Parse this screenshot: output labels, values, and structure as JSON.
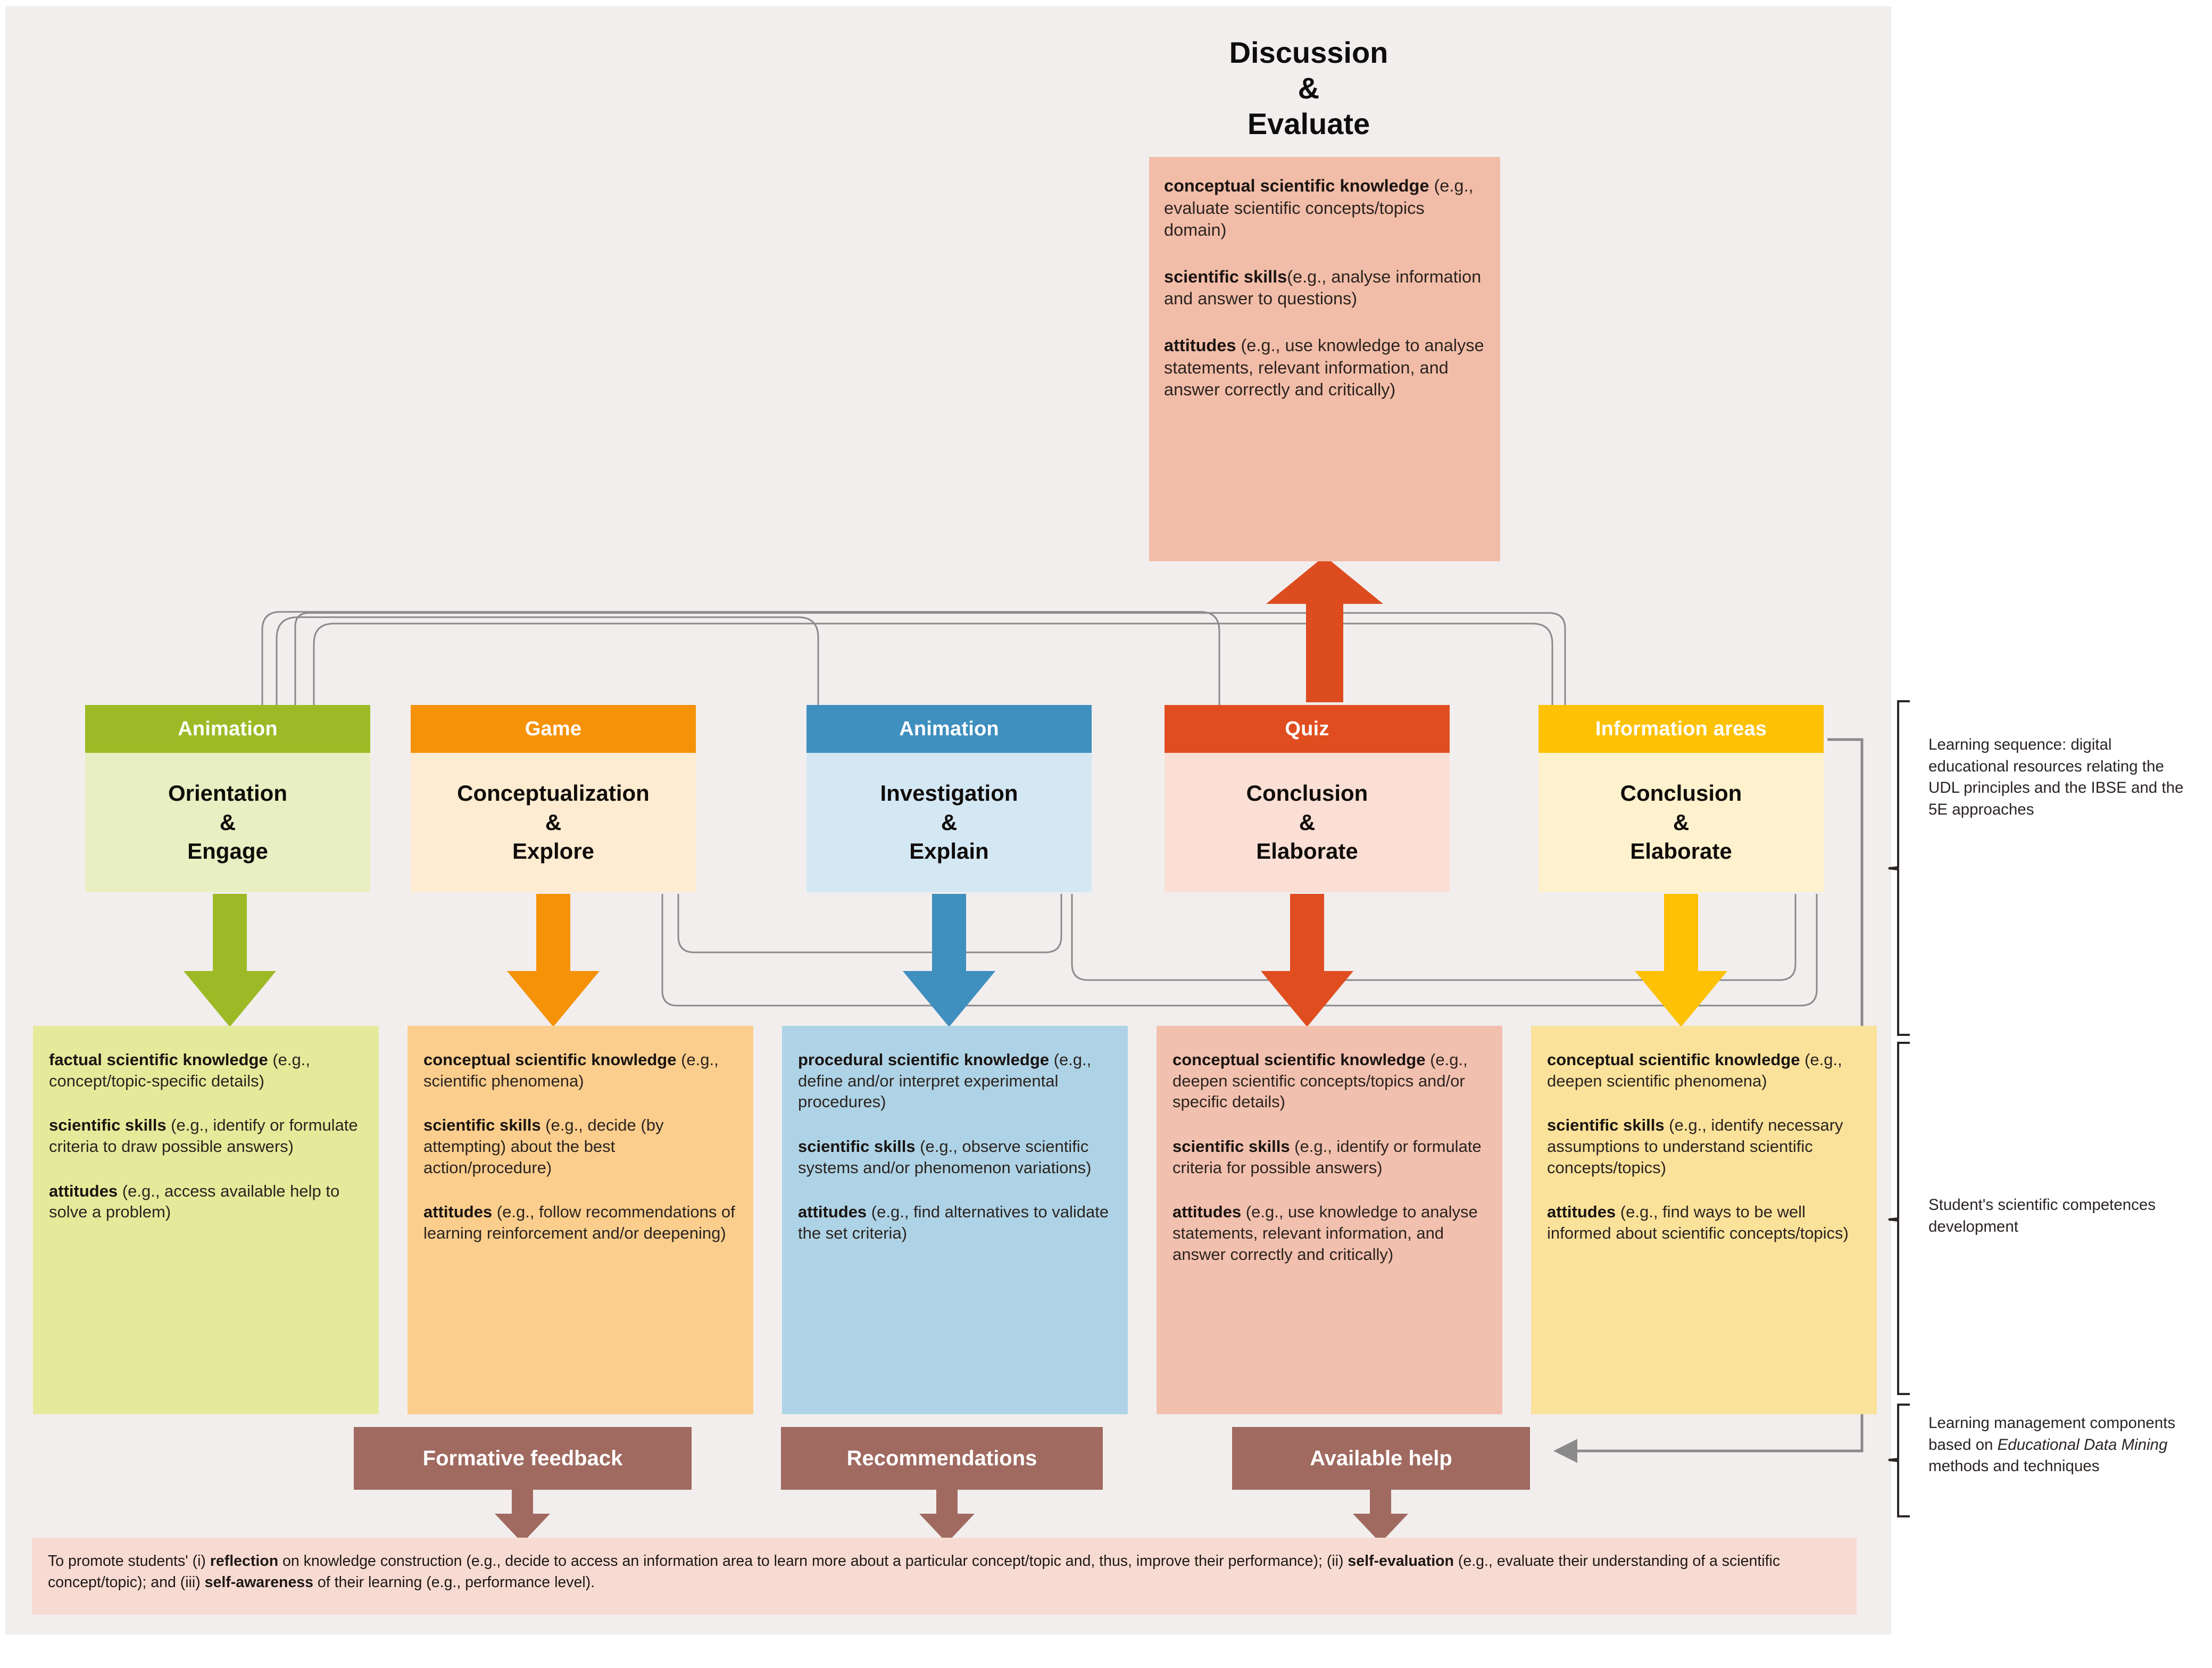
{
  "diagram": {
    "title": "Discussion\n&\nEvaluate",
    "title_lines": [
      "Discussion",
      "&",
      "Evaluate"
    ]
  },
  "colors": {
    "canvas_bg": "#f2eeee",
    "green_header": "#9dba26",
    "green_body": "#e8f0c3",
    "orange_header": "#f59208",
    "orange_body": "#fdecd1",
    "blue_header": "#3f8fbf",
    "blue_body": "#d4e8f4",
    "red_header": "#e04e20",
    "red_body": "#fbdfd5",
    "yellow_header": "#fdc105",
    "yellow_body": "#fdf2cd",
    "low_green": "#e3eb9a",
    "low_orange": "#fbce8d",
    "low_blue": "#aed3e6",
    "low_red": "#f2c0ae",
    "low_yellow": "#fae29a",
    "discussion_box": "#f2bda8",
    "lms_brown": "#a06a60",
    "footer_pink": "#f7dbd2",
    "connector_grey": "#8a8a8a"
  },
  "discussion_box": {
    "knowledge_label": "conceptual scientific knowledge",
    "knowledge_text": " (e.g., evaluate scientific concepts/topics domain)",
    "skills_label": "scientific skills",
    "skills_text": "(e.g., analyse information and answer to questions)",
    "attitudes_label": "attitudes",
    "attitudes_text": " (e.g., use knowledge to analyse statements,  relevant information, and answer correctly and critically)"
  },
  "stages": [
    {
      "resource": "Animation",
      "phase_lines": [
        "Orientation",
        "&",
        "Engage"
      ],
      "phase": "Orientation & Engage"
    },
    {
      "resource": "Game",
      "phase_lines": [
        "Conceptualization",
        "&",
        "Explore"
      ],
      "phase": "Conceptualization & Explore"
    },
    {
      "resource": "Animation",
      "phase_lines": [
        "Investigation",
        "&",
        "Explain"
      ],
      "phase": "Investigation & Explain"
    },
    {
      "resource": "Quiz",
      "phase_lines": [
        "Conclusion",
        "&",
        "Elaborate"
      ],
      "phase": "Conclusion & Elaborate"
    },
    {
      "resource": "Information areas",
      "phase_lines": [
        "Conclusion",
        "&",
        "Elaborate"
      ],
      "phase": "Conclusion & Elaborate"
    }
  ],
  "competences": [
    {
      "knowledge_label": "factual scientific knowledge",
      "knowledge_text": " (e.g., concept/topic-specific details)",
      "skills_label": "scientific skills",
      "skills_text": " (e.g., identify or formulate criteria to draw possible answers)",
      "attitudes_label": "attitudes",
      "attitudes_text": " (e.g., access available  help to solve a problem)"
    },
    {
      "knowledge_label": "conceptual scientific knowledge",
      "knowledge_text": " (e.g., scientific phenomena)",
      "skills_label": "scientific skills",
      "skills_text": " (e.g., decide (by attempting) about the best action/procedure)",
      "attitudes_label": "attitudes",
      "attitudes_text": " (e.g., follow recommendations of learning reinforcement and/or deepening)"
    },
    {
      "knowledge_label": "procedural scientific knowledge",
      "knowledge_text": " (e.g., define and/or interpret experimental procedures)",
      "skills_label": "scientific skills",
      "skills_text": " (e.g., observe scientific systems and/or phenomenon variations)",
      "attitudes_label": "attitudes",
      "attitudes_text": " (e.g., find alternatives to validate the set criteria)"
    },
    {
      "knowledge_label": "conceptual scientific knowledge",
      "knowledge_text": " (e.g., deepen scientific concepts/topics and/or specific details)",
      "skills_label": "scientific skills",
      "skills_text": " (e.g., identify or formulate criteria for possible answers)",
      "attitudes_label": "attitudes",
      "attitudes_text": " (e.g., use knowledge to analyse statements,  relevant information, and answer correctly and critically)"
    },
    {
      "knowledge_label": "conceptual scientific knowledge",
      "knowledge_text": " (e.g., deepen scientific phenomena)",
      "skills_label": "scientific skills",
      "skills_text": " (e.g., identify necessary assumptions to understand scientific concepts/topics)",
      "attitudes_label": "attitudes",
      "attitudes_text": " (e.g., find ways to be well informed about scientific concepts/topics)"
    }
  ],
  "lms_components": [
    {
      "label": "Formative feedback"
    },
    {
      "label": "Recommendations"
    },
    {
      "label": "Available help"
    }
  ],
  "annotations": {
    "learning_sequence": "Learning sequence: digital educational resources relating the UDL principles and the IBSE and the 5E approaches",
    "competences": "Student's scientific competences development",
    "lms_line1": "Learning management components based on ",
    "lms_italic": "Educational Data Mining",
    "lms_line2": " methods and techniques"
  },
  "footer": {
    "seg1": "To promote students' (i) ",
    "b1": "reflection",
    "seg2": " on knowledge construction (e.g., decide to access an information area to learn more about a particular concept/topic and, thus, improve their performance); (ii) ",
    "b2": "self-evaluation",
    "seg3": " (e.g., evaluate their understanding of a scientific concept/topic); and (iii) ",
    "b3": "self-awareness",
    "seg4": " of their learning (e.g., performance level)."
  }
}
